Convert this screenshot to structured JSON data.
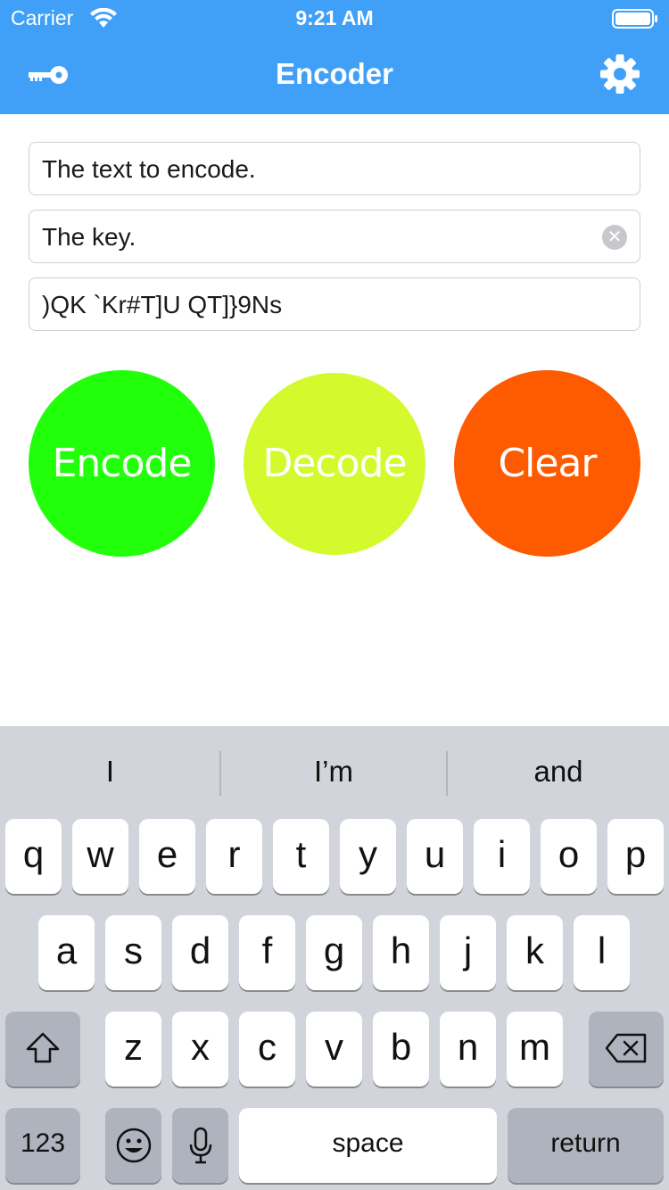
{
  "status_bar": {
    "carrier": "Carrier",
    "time": "9:21 AM"
  },
  "nav": {
    "title": "Encoder",
    "left_icon": "key-icon",
    "right_icon": "gear-icon"
  },
  "fields": {
    "text_to_encode": "The text to encode.",
    "key": "The key.",
    "output": ")QK `Kr#T]U QT]}9Ns"
  },
  "buttons": {
    "encode": "Encode",
    "decode": "Decode",
    "clear": "Clear"
  },
  "colors": {
    "nav_bar": "#40a0f7",
    "encode": "#22ff0a",
    "decode": "#d4f92c",
    "clear": "#fe5a00"
  },
  "keyboard": {
    "suggestions": [
      "I",
      "I’m",
      "and"
    ],
    "row1": [
      "q",
      "w",
      "e",
      "r",
      "t",
      "y",
      "u",
      "i",
      "o",
      "p"
    ],
    "row2": [
      "a",
      "s",
      "d",
      "f",
      "g",
      "h",
      "j",
      "k",
      "l"
    ],
    "row3": [
      "z",
      "x",
      "c",
      "v",
      "b",
      "n",
      "m"
    ],
    "numbers_label": "123",
    "space_label": "space",
    "return_label": "return"
  }
}
